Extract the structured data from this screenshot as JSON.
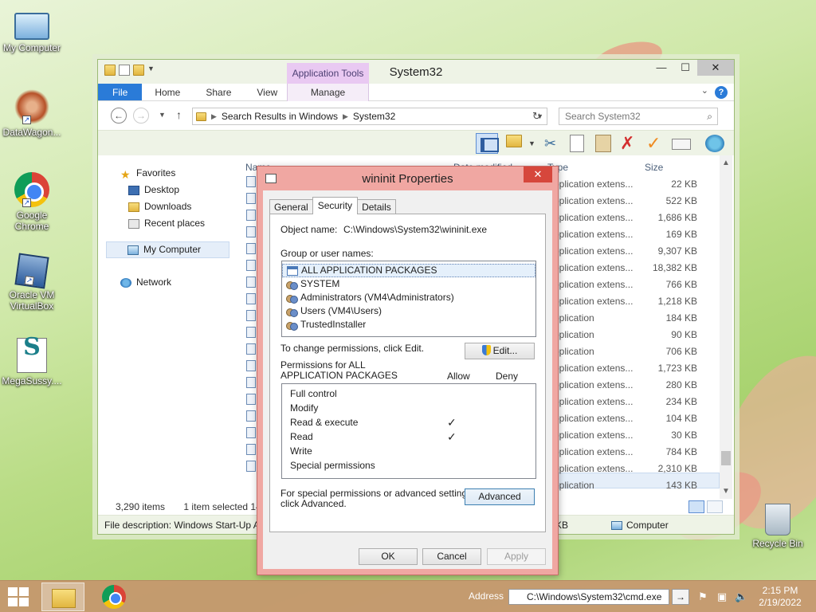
{
  "desktop": {
    "icons": [
      {
        "label": "My Computer"
      },
      {
        "label": "DataWagon..."
      },
      {
        "label": "Google Chrome"
      },
      {
        "label": "Oracle VM VirtualBox"
      },
      {
        "label": "MegaSussy...."
      },
      {
        "label": "Recycle Bin"
      }
    ]
  },
  "explorer": {
    "title": "System32",
    "context_tab": "Application Tools",
    "ribbon_tabs": {
      "file": "File",
      "home": "Home",
      "share": "Share",
      "view": "View",
      "manage": "Manage"
    },
    "address": {
      "part1": "Search Results in Windows",
      "part2": "System32"
    },
    "search_placeholder": "Search System32",
    "columns": {
      "name": "Name",
      "date": "Date modified",
      "type": "Type",
      "size": "Size"
    },
    "rows": [
      {
        "type": "Application extens...",
        "size": "22 KB"
      },
      {
        "type": "Application extens...",
        "size": "522 KB"
      },
      {
        "type": "Application extens...",
        "size": "1,686 KB"
      },
      {
        "type": "Application extens...",
        "size": "169 KB"
      },
      {
        "type": "Application extens...",
        "size": "9,307 KB"
      },
      {
        "type": "Application extens...",
        "size": "18,382 KB"
      },
      {
        "type": "Application extens...",
        "size": "766 KB"
      },
      {
        "type": "Application extens...",
        "size": "1,218 KB"
      },
      {
        "type": "Application",
        "size": "184 KB"
      },
      {
        "type": "Application",
        "size": "90 KB"
      },
      {
        "type": "Application",
        "size": "706 KB"
      },
      {
        "type": "Application extens...",
        "size": "1,723 KB"
      },
      {
        "type": "Application extens...",
        "size": "280 KB"
      },
      {
        "type": "Application extens...",
        "size": "234 KB"
      },
      {
        "type": "Application extens...",
        "size": "104 KB"
      },
      {
        "type": "Application extens...",
        "size": "30 KB"
      },
      {
        "type": "Application extens...",
        "size": "784 KB"
      },
      {
        "type": "Application extens...",
        "size": "2,310 KB"
      },
      {
        "type": "Application",
        "size": "143 KB"
      }
    ],
    "nav": {
      "favorites": "Favorites",
      "desktop": "Desktop",
      "downloads": "Downloads",
      "recent": "Recent places",
      "my_computer": "My Computer",
      "network": "Network"
    },
    "status": {
      "items": "3,290 items",
      "selected": "1 item selected  142 KB",
      "file_description": "File description: Windows Start-Up Application",
      "size": "KB",
      "location": "Computer"
    }
  },
  "dialog": {
    "title": "wininit Properties",
    "tabs": {
      "general": "General",
      "security": "Security",
      "details": "Details"
    },
    "object_name_label": "Object name:",
    "object_name_value": "C:\\Windows\\System32\\wininit.exe",
    "group_label": "Group or user names:",
    "users": [
      "ALL APPLICATION PACKAGES",
      "SYSTEM",
      "Administrators (VM4\\Administrators)",
      "Users (VM4\\Users)",
      "TrustedInstaller"
    ],
    "change_text": "To change permissions, click Edit.",
    "edit_button": "Edit...",
    "perm_label_line1": "Permissions for ALL",
    "perm_label_line2": "APPLICATION PACKAGES",
    "allow": "Allow",
    "deny": "Deny",
    "permissions": [
      {
        "name": "Full control",
        "allow": ""
      },
      {
        "name": "Modify",
        "allow": ""
      },
      {
        "name": "Read & execute",
        "allow": "✓"
      },
      {
        "name": "Read",
        "allow": "✓"
      },
      {
        "name": "Write",
        "allow": ""
      },
      {
        "name": "Special permissions",
        "allow": ""
      }
    ],
    "advanced_text_line1": "For special permissions or advanced settings,",
    "advanced_text_line2": "click Advanced.",
    "advanced_button": "Advanced",
    "ok": "OK",
    "cancel": "Cancel",
    "apply": "Apply"
  },
  "taskbar": {
    "address_label": "Address",
    "address_value": "C:\\Windows\\System32\\cmd.exe",
    "time": "2:15 PM",
    "date": "2/19/2022"
  }
}
